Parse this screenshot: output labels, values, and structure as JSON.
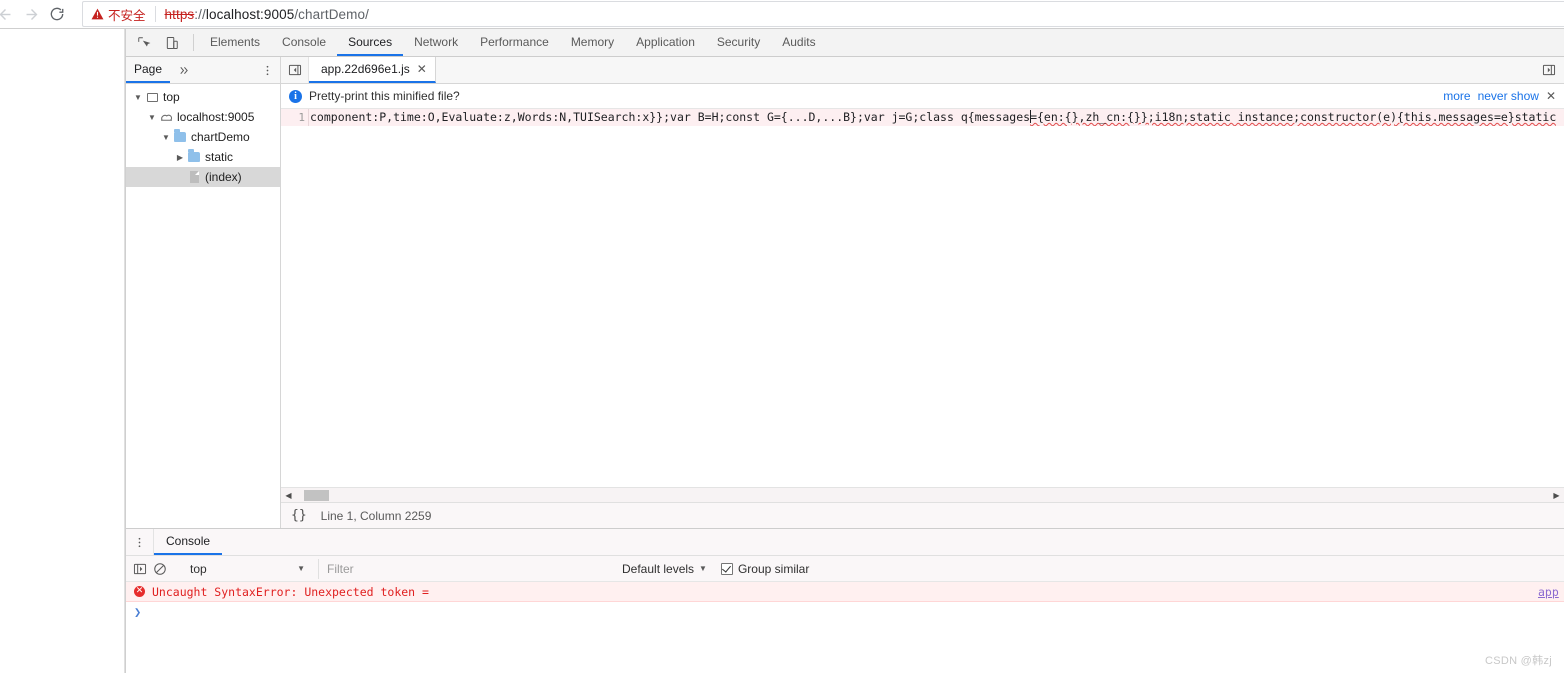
{
  "browser": {
    "nav": {
      "back_icon": "arrow-left-icon",
      "forward_icon": "arrow-right-icon",
      "reload_icon": "reload-icon"
    },
    "omnibox": {
      "security_label": "不安全",
      "security_icon": "warning-triangle-icon",
      "url_scheme": "https",
      "url_separator": "://",
      "url_host": "localhost:9005",
      "url_path": "/chartDemo/",
      "url_full": "https://localhost:9005/chartDemo/"
    }
  },
  "devtools": {
    "toolbar_icons": {
      "inspect": "inspect-cursor-icon",
      "device": "device-toolbar-icon"
    },
    "tabs": [
      {
        "label": "Elements",
        "active": false
      },
      {
        "label": "Console",
        "active": false
      },
      {
        "label": "Sources",
        "active": true
      },
      {
        "label": "Network",
        "active": false
      },
      {
        "label": "Performance",
        "active": false
      },
      {
        "label": "Memory",
        "active": false
      },
      {
        "label": "Application",
        "active": false
      },
      {
        "label": "Security",
        "active": false
      },
      {
        "label": "Audits",
        "active": false
      }
    ],
    "navigator": {
      "tab_label": "Page",
      "more_tabs_icon": "chevron-double-right-icon",
      "menu_icon": "more-vertical-icon",
      "tree": [
        {
          "label": "top",
          "icon": "frame-icon",
          "depth": 0,
          "twisty": "▼",
          "selected": false
        },
        {
          "label": "localhost:9005",
          "icon": "cloud-icon",
          "depth": 1,
          "twisty": "▼",
          "selected": false
        },
        {
          "label": "chartDemo",
          "icon": "folder-icon",
          "depth": 2,
          "twisty": "▼",
          "selected": false
        },
        {
          "label": "static",
          "icon": "folder-icon",
          "depth": 3,
          "twisty": "▶",
          "selected": false
        },
        {
          "label": "(index)",
          "icon": "document-icon",
          "depth": 4,
          "twisty": "",
          "selected": true
        }
      ]
    },
    "editor": {
      "collapse_icon": "collapse-navigator-icon",
      "sidebar_icon": "show-debugger-sidebar-icon",
      "tab": {
        "filename": "app.22d696e1.js",
        "close_icon": "close-icon"
      },
      "infobar": {
        "icon": "info-icon",
        "message": "Pretty-print this minified file?",
        "more_label": "more",
        "never_show_label": "never show",
        "close_icon": "close-icon"
      },
      "code": {
        "line_number": "1",
        "text_before_error": "component:P,time:O,Evaluate:z,Words:N,TUISearch:x}};var B=H;const G={...D,...B};var j=G;class q{messages",
        "text_error": "={en:{},zh_cn:{}};i18n;static instance;constructor(e){this.messages=e}static",
        "text_full": "component:P,time:O,Evaluate:z,Words:N,TUISearch:x}};var B=H;const G={...D,...B};var j=G;class q{messages={en:{},zh_cn:{}};i18n;static instance;constructor(e){this.messages=e}static"
      },
      "scrollbar": {
        "left_arrow": "scroll-left-icon",
        "right_arrow": "scroll-right-icon"
      },
      "status": {
        "format_icon": "{}",
        "position": "Line 1, Column 2259"
      }
    }
  },
  "drawer": {
    "menu_icon": "more-vertical-icon",
    "tab_label": "Console",
    "toolbar": {
      "sidebar_icon": "console-sidebar-icon",
      "clear_icon": "clear-console-icon",
      "context_value": "top",
      "context_caret": "▼",
      "filter_placeholder": "Filter",
      "levels_label": "Default levels",
      "levels_caret": "▼",
      "group_similar_label": "Group similar",
      "group_similar_checked": true
    },
    "messages": [
      {
        "icon": "error-icon",
        "icon_glyph": "✕",
        "text": "Uncaught SyntaxError: Unexpected token =",
        "source": "app",
        "level": "error"
      }
    ],
    "prompt_glyph": "❯"
  },
  "watermark": "CSDN @韩zj",
  "colors": {
    "accent": "#1a73e8",
    "error": "#e02020",
    "error_bg": "#fff0f0",
    "warn_red": "#c5221f",
    "code_bg": "#fdeff1",
    "folder_blue": "#8fc0ea"
  }
}
